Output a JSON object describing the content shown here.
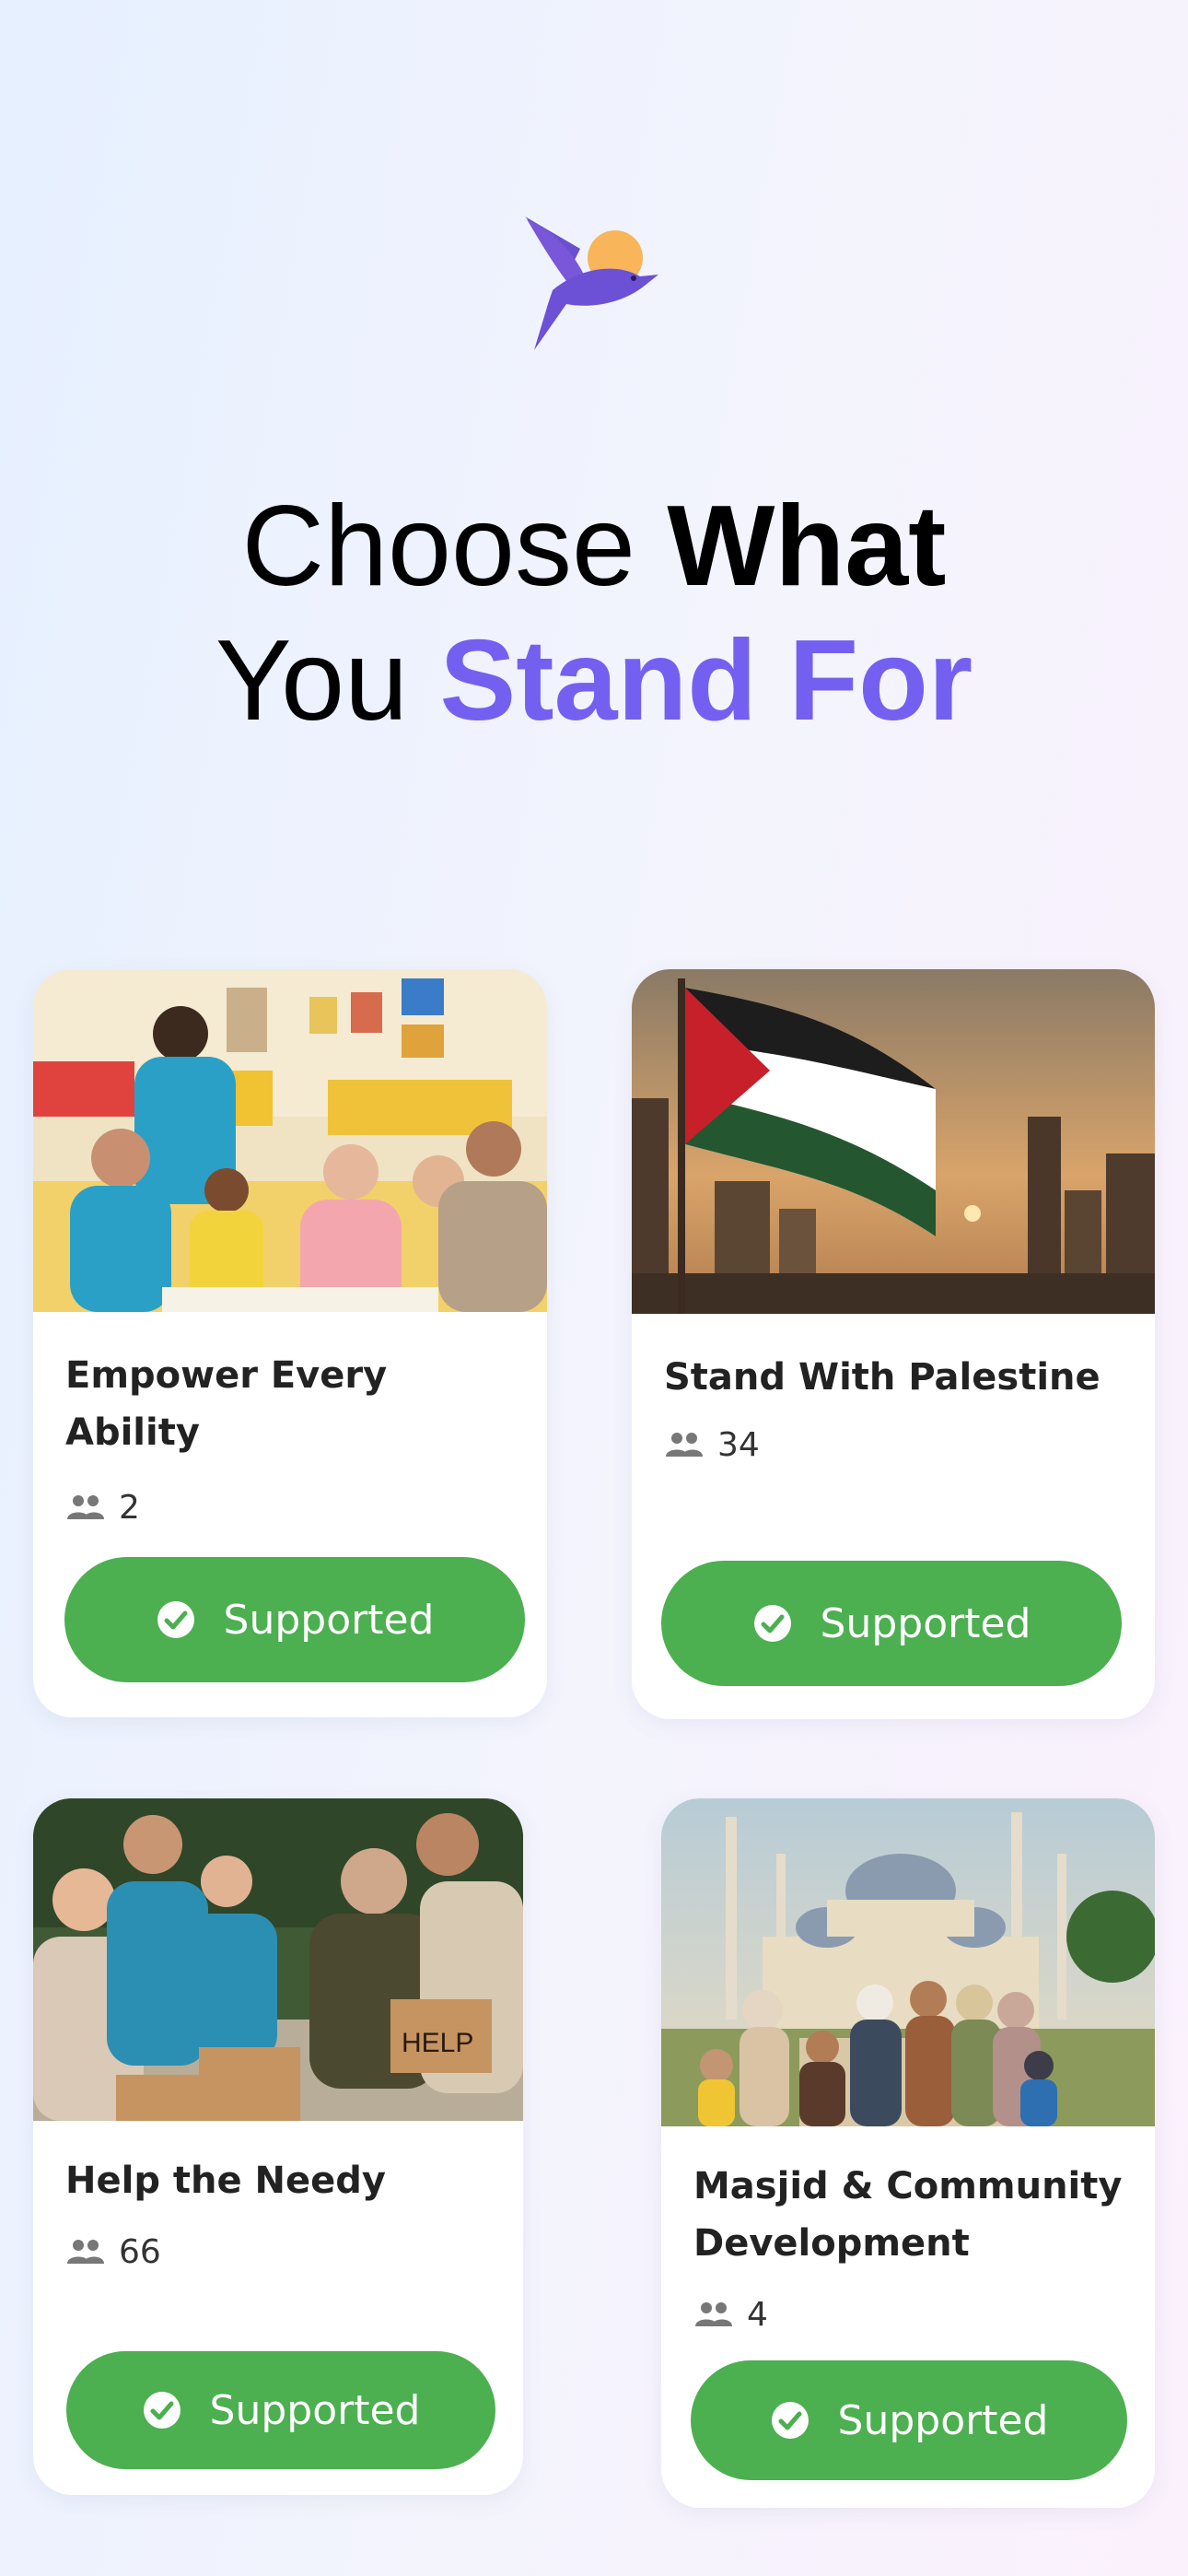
{
  "headline": {
    "line1_light": "Choose",
    "line1_bold": "What",
    "line2_light": "You",
    "line2_accent": "Stand For"
  },
  "colors": {
    "accent": "#7460f0",
    "button": "#4caf50",
    "card": "#ffffff"
  },
  "causes": [
    {
      "title": "Empower Every Ability",
      "supporters": "2",
      "button_label": "Supported",
      "icon": "people-icon"
    },
    {
      "title": "Stand With Palestine",
      "supporters": "34",
      "button_label": "Supported",
      "icon": "people-icon"
    },
    {
      "title": "Help the Needy",
      "supporters": "66",
      "button_label": "Supported",
      "icon": "people-icon"
    },
    {
      "title": "Masjid & Community Development",
      "supporters": "4",
      "button_label": "Supported",
      "icon": "people-icon"
    }
  ]
}
